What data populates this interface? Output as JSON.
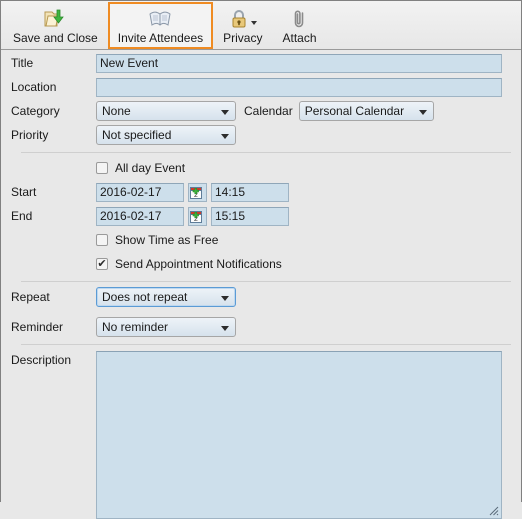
{
  "toolbar": {
    "buttons": [
      {
        "label": "Save and Close",
        "icon": "folder-save-icon",
        "selected": false,
        "has_menu": false
      },
      {
        "label": "Invite Attendees",
        "icon": "open-book-icon",
        "selected": true,
        "has_menu": false
      },
      {
        "label": "Privacy",
        "icon": "padlock-icon",
        "selected": false,
        "has_menu": true
      },
      {
        "label": "Attach",
        "icon": "paperclip-icon",
        "selected": false,
        "has_menu": false
      }
    ]
  },
  "form": {
    "title": {
      "label": "Title",
      "value": "New Event",
      "placeholder": ""
    },
    "location": {
      "label": "Location",
      "value": "",
      "placeholder": ""
    },
    "category": {
      "label": "Category",
      "value": "None"
    },
    "calendar": {
      "label": "Calendar",
      "value": "Personal Calendar"
    },
    "priority": {
      "label": "Priority",
      "value": "Not specified"
    },
    "all_day": {
      "label": "All day Event",
      "checked": false
    },
    "start": {
      "label": "Start",
      "date": "2016-02-17",
      "time": "14:15"
    },
    "end": {
      "label": "End",
      "date": "2016-02-17",
      "time": "15:15"
    },
    "show_free": {
      "label": "Show Time as Free",
      "checked": false
    },
    "send_notifications": {
      "label": "Send Appointment Notifications",
      "checked": true
    },
    "repeat": {
      "label": "Repeat",
      "value": "Does not repeat",
      "focused": true
    },
    "reminder": {
      "label": "Reminder",
      "value": "No reminder"
    },
    "description": {
      "label": "Description",
      "value": "",
      "placeholder": ""
    }
  },
  "colors": {
    "highlight": "#ef8b22",
    "field_bg": "#cddfeb",
    "window_bg": "#e8e8e8",
    "focus_border": "#5b9bd5"
  },
  "checkmark": "✔"
}
